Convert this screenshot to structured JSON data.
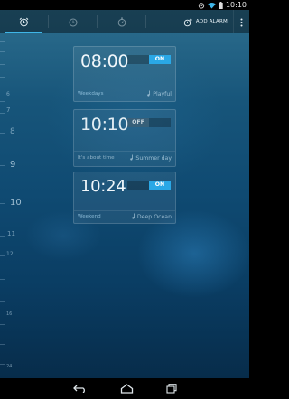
{
  "status_bar": {
    "time": "10:10",
    "icons": [
      "alarm-icon",
      "wifi-icon",
      "battery-icon"
    ]
  },
  "action_bar": {
    "tabs": [
      {
        "icon": "alarm-clock-icon",
        "active": true
      },
      {
        "icon": "clock-icon",
        "active": false
      },
      {
        "icon": "stopwatch-icon",
        "active": false
      }
    ],
    "add_alarm_label": "ADD ALARM",
    "overflow_icon": "overflow-menu-icon"
  },
  "ruler": {
    "labels": [
      "6",
      "7",
      "8",
      "9",
      "10",
      "11",
      "12",
      "16",
      "24"
    ]
  },
  "alarms": [
    {
      "time": "08:00",
      "state": "ON",
      "label": "Weekdays",
      "ringtone": "Playful"
    },
    {
      "time": "10:10",
      "state": "OFF",
      "label": "It's about time",
      "ringtone": "Summer day"
    },
    {
      "time": "10:24",
      "state": "ON",
      "label": "Weekend",
      "ringtone": "Deep Ocean"
    }
  ],
  "nav_bar": {
    "icons": [
      "back-icon",
      "home-icon",
      "recents-icon"
    ]
  },
  "colors": {
    "accent": "#2aa8e6",
    "tab_indicator": "#3fb6e8"
  }
}
